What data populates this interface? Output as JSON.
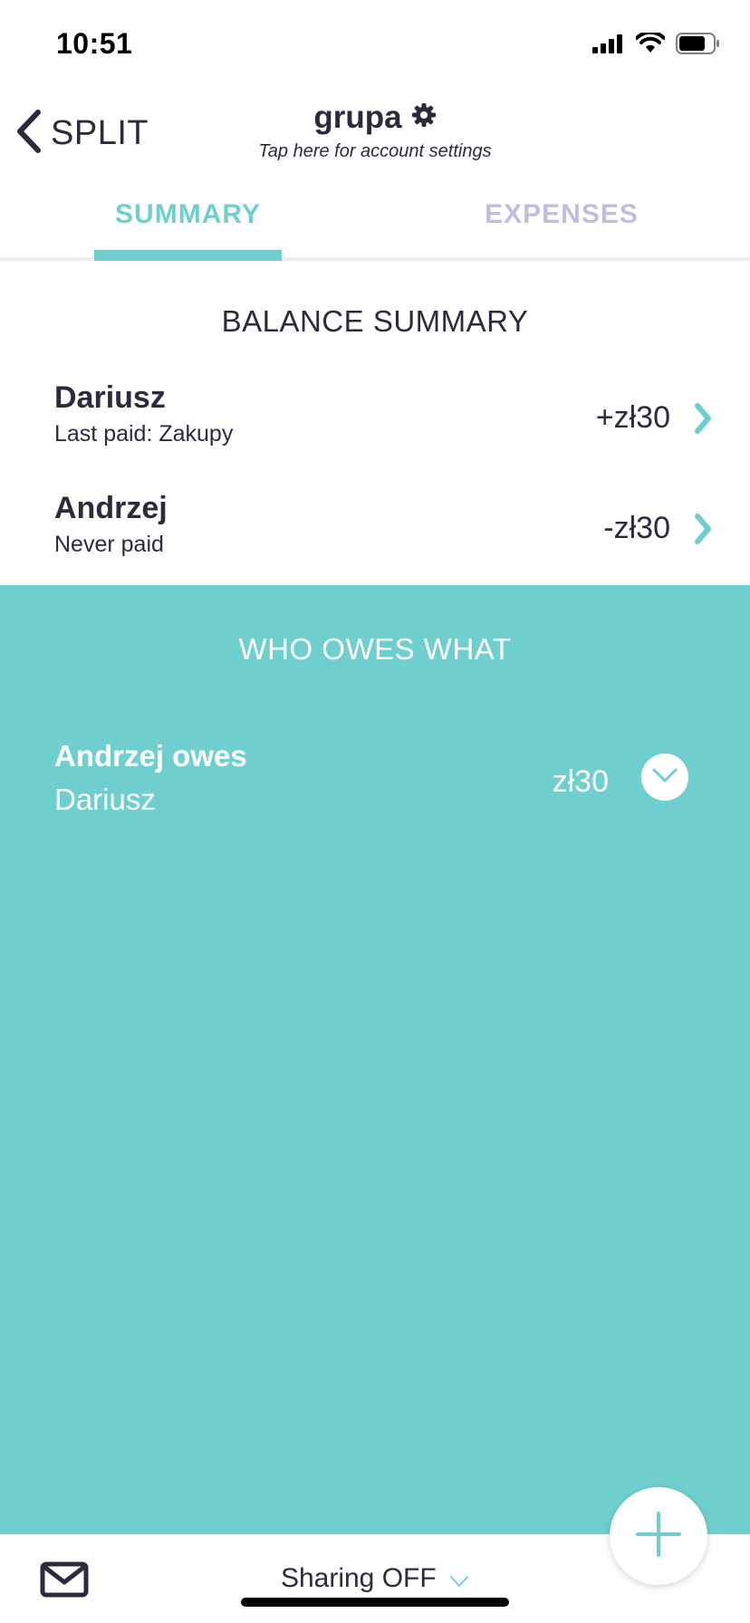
{
  "status_bar": {
    "time": "10:51"
  },
  "nav": {
    "back_label": "SPLIT",
    "group_title": "grupa",
    "group_subtitle": "Tap here for account settings"
  },
  "tabs": [
    {
      "label": "SUMMARY",
      "active": true
    },
    {
      "label": "EXPENSES",
      "active": false
    }
  ],
  "balance_summary": {
    "title": "BALANCE SUMMARY",
    "rows": [
      {
        "name": "Dariusz",
        "subtitle": "Last paid: Zakupy",
        "amount": "+zł30"
      },
      {
        "name": "Andrzej",
        "subtitle": "Never paid",
        "amount": "-zł30"
      }
    ]
  },
  "who_owes_what": {
    "title": "WHO OWES WHAT",
    "rows": [
      {
        "debtor_label": "Andrzej owes",
        "creditor": "Dariusz",
        "amount": "zł30"
      }
    ]
  },
  "bottom_bar": {
    "sharing_label": "Sharing OFF"
  },
  "colors": {
    "accent": "#6fcfcf",
    "text_dark": "#2b2b3c",
    "tab_inactive": "#c1bde0"
  },
  "icons": {
    "back": "chevron-left-icon",
    "settings": "gear-icon",
    "row_chevron": "chevron-right-icon",
    "expand": "chevron-down-icon",
    "mail": "mail-icon",
    "add": "plus-icon"
  }
}
